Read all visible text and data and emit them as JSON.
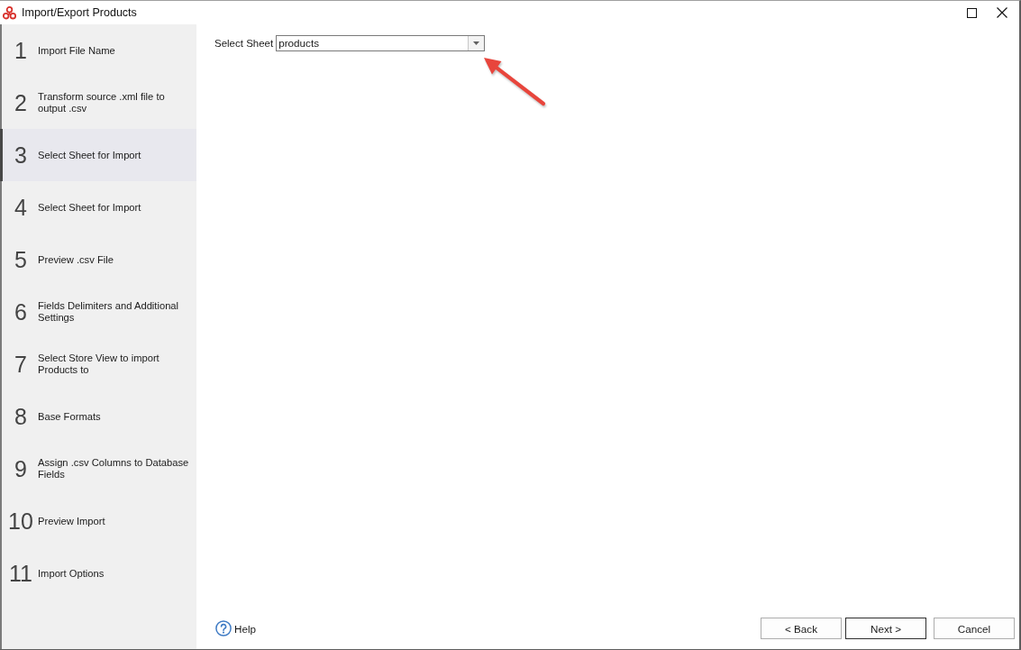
{
  "window": {
    "title": "Import/Export Products"
  },
  "steps": [
    {
      "number": "1",
      "label": "Import File Name",
      "selected": false
    },
    {
      "number": "2",
      "label": "Transform source .xml file to output .csv",
      "selected": false
    },
    {
      "number": "3",
      "label": "Select Sheet for Import",
      "selected": true
    },
    {
      "number": "4",
      "label": "Select Sheet for Import",
      "selected": false
    },
    {
      "number": "5",
      "label": "Preview .csv File",
      "selected": false
    },
    {
      "number": "6",
      "label": "Fields Delimiters and Additional Settings",
      "selected": false
    },
    {
      "number": "7",
      "label": "Select Store View to import Products to",
      "selected": false
    },
    {
      "number": "8",
      "label": "Base Formats",
      "selected": false
    },
    {
      "number": "9",
      "label": "Assign .csv Columns to Database Fields",
      "selected": false
    },
    {
      "number": "10",
      "label": "Preview Import",
      "selected": false
    },
    {
      "number": "11",
      "label": "Import Options",
      "selected": false
    }
  ],
  "sheet_select": {
    "label": "Select Sheet",
    "value": "products"
  },
  "help_link": {
    "label": "Help"
  },
  "buttons": [
    {
      "label": "< Back",
      "default": false
    },
    {
      "label": "Next >",
      "default": true
    },
    {
      "label": "Cancel",
      "default": false
    }
  ]
}
